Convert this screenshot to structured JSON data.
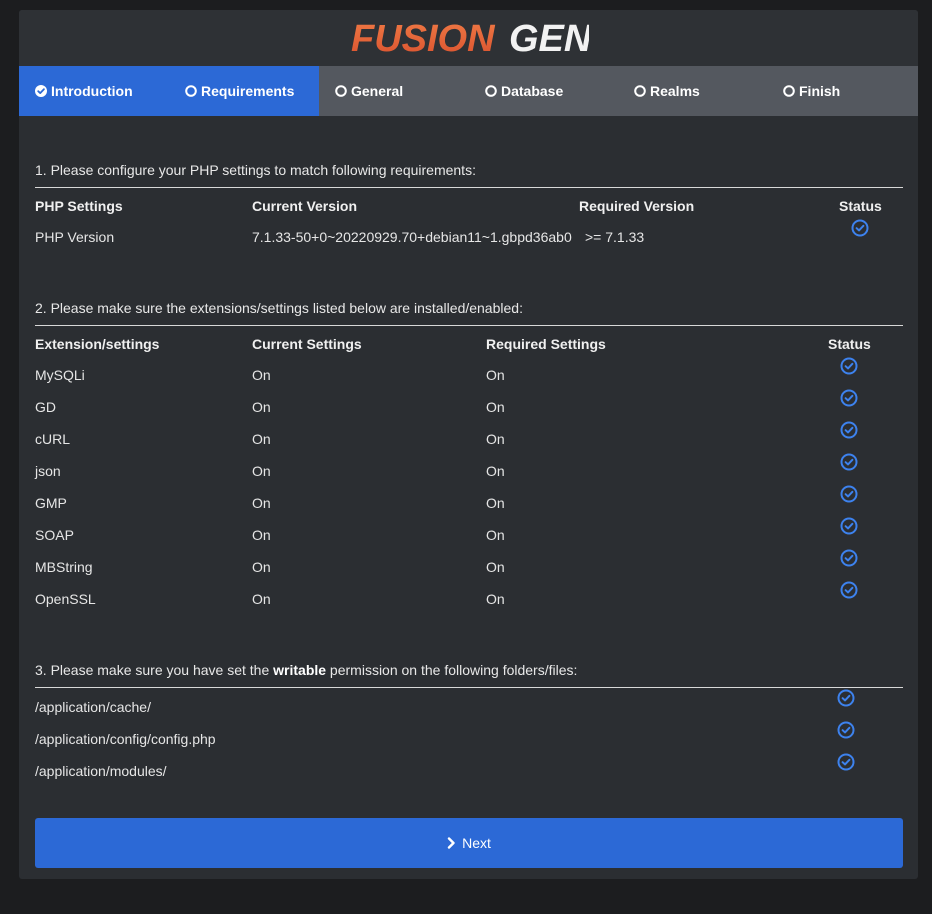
{
  "logo": {
    "part1": "FUSION",
    "part2": "GEN"
  },
  "colors": {
    "accent": "#2c69d6",
    "logo_orange": "#e8603a",
    "panel": "#2b2e32",
    "steps_bg": "#54585f"
  },
  "steps": [
    {
      "label": "Introduction",
      "state": "done"
    },
    {
      "label": "Requirements",
      "state": "active"
    },
    {
      "label": "General",
      "state": "pending"
    },
    {
      "label": "Database",
      "state": "pending"
    },
    {
      "label": "Realms",
      "state": "pending"
    },
    {
      "label": "Finish",
      "state": "pending"
    }
  ],
  "section1": {
    "title": "1. Please configure your PHP settings to match following requirements:",
    "headers": [
      "PHP Settings",
      "Current Version",
      "Required Version",
      "Status"
    ],
    "row": {
      "name": "PHP Version",
      "current": "7.1.33-50+0~20220929.70+debian11~1.gbpd36ab0",
      "required": ">= 7.1.33"
    }
  },
  "section2": {
    "title": "2. Please make sure the extensions/settings listed below are installed/enabled:",
    "headers": [
      "Extension/settings",
      "Current Settings",
      "Required Settings",
      "Status"
    ],
    "rows": [
      {
        "name": "MySQLi",
        "current": "On",
        "required": "On"
      },
      {
        "name": "GD",
        "current": "On",
        "required": "On"
      },
      {
        "name": "cURL",
        "current": "On",
        "required": "On"
      },
      {
        "name": "json",
        "current": "On",
        "required": "On"
      },
      {
        "name": "GMP",
        "current": "On",
        "required": "On"
      },
      {
        "name": "SOAP",
        "current": "On",
        "required": "On"
      },
      {
        "name": "MBString",
        "current": "On",
        "required": "On"
      },
      {
        "name": "OpenSSL",
        "current": "On",
        "required": "On"
      }
    ]
  },
  "section3": {
    "title_pre": "3. Please make sure you have set the ",
    "title_bold": "writable",
    "title_post": " permission on the following folders/files:",
    "paths": [
      "/application/cache/",
      "/application/config/config.php",
      "/application/modules/"
    ]
  },
  "next_button": {
    "label": "Next",
    "icon": "chevron-right-icon"
  }
}
